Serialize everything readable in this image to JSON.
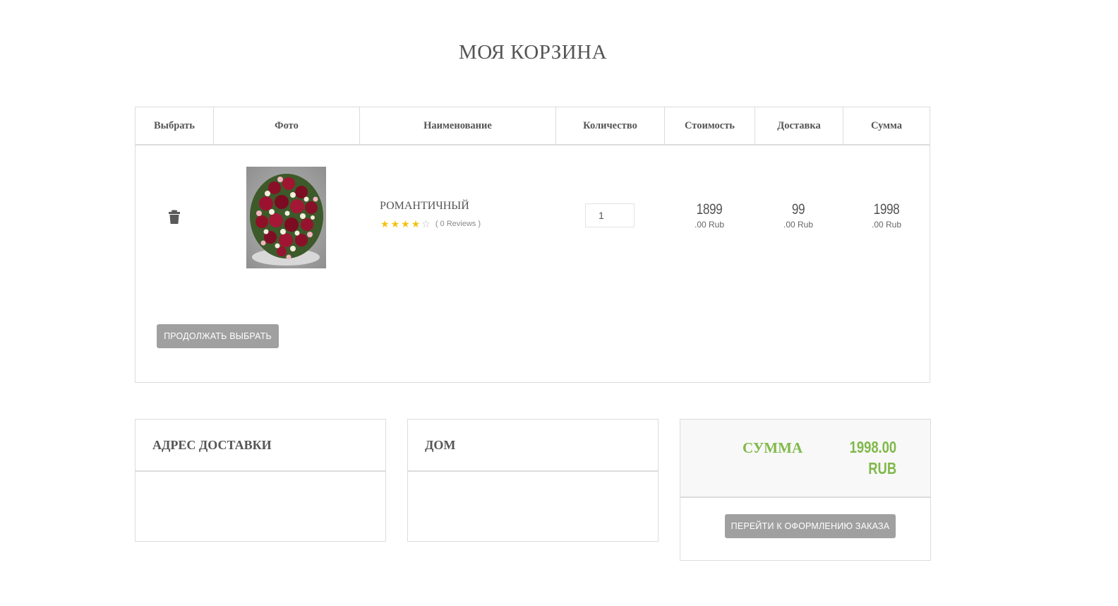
{
  "page": {
    "title": "МОЯ КОРЗИНА"
  },
  "cart": {
    "columns": [
      "Выбрать",
      "Фото",
      "Наименование",
      "Количество",
      "Стоимость",
      "Доставка",
      "Сумма"
    ],
    "item": {
      "name": "РОМАНТИЧНЫЙ",
      "rating": 4,
      "rating_max": 5,
      "reviews": "( 0 Reviews )",
      "quantity": "1",
      "price": {
        "int": "1899",
        "cur": ".00 Rub"
      },
      "delivery": {
        "int": "99",
        "cur": ".00 Rub"
      },
      "total": {
        "int": "1998",
        "cur": ".00 Rub"
      }
    },
    "continue_label": "ПРОДОЛЖАТЬ ВЫБРАТЬ"
  },
  "address": {
    "title": "АДРЕС ДОСТАВКИ"
  },
  "home": {
    "title": "ДОМ"
  },
  "summary": {
    "label": "СУММА",
    "amount": "1998.00",
    "currency": "RUB",
    "checkout_label": "ПЕРЕЙТИ К ОФОРМЛЕНИЮ ЗАКАЗА"
  },
  "colors": {
    "accent": "#80b94a",
    "button": "#a0a0a0",
    "star": "#f2c20e",
    "border": "#dcdcdc"
  },
  "icons": {
    "delete": "trash-icon",
    "rating": "star-icon"
  }
}
